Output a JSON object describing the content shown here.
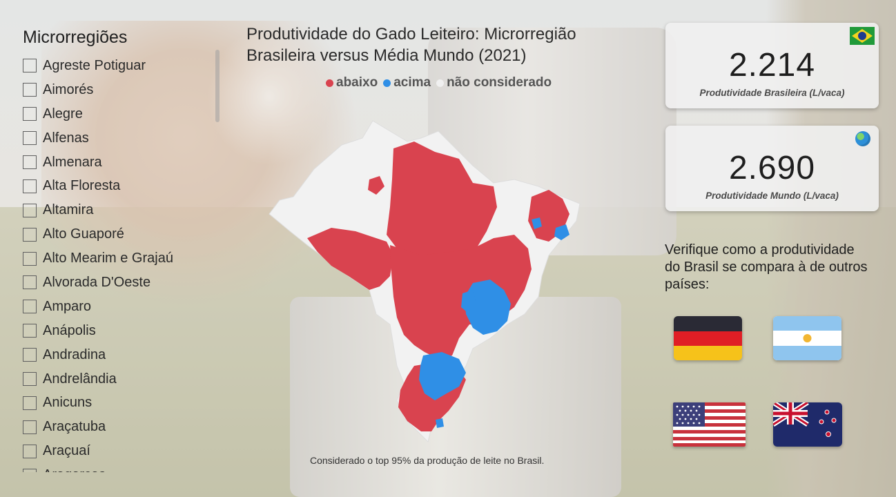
{
  "slicer": {
    "title": "Microrregiões",
    "items": [
      "Agreste Potiguar",
      "Aimorés",
      "Alegre",
      "Alfenas",
      "Almenara",
      "Alta Floresta",
      "Altamira",
      "Alto Guaporé",
      "Alto Mearim e Grajaú",
      "Alvorada D'Oeste",
      "Amparo",
      "Anápolis",
      "Andradina",
      "Andrelândia",
      "Anicuns",
      "Araçatuba",
      "Araçuaí",
      "Aragarças"
    ]
  },
  "map": {
    "title": "Produtividade do Gado Leiteiro: Microrregião Brasileira versus Média Mundo (2021)",
    "legend": [
      {
        "label": "abaixo",
        "color": "#d9434f"
      },
      {
        "label": "acima",
        "color": "#2f8fe6"
      },
      {
        "label": "não considerado",
        "color": "#f0f0f0"
      }
    ],
    "note": "Considerado o top 95% da produção de leite no Brasil."
  },
  "kpi": {
    "brazil": {
      "value": "2.214",
      "caption": "Produtividade Brasileira (L/vaca)",
      "icon": "brazil-flag-icon"
    },
    "world": {
      "value": "2.690",
      "caption": "Produtividade Mundo (L/vaca)",
      "icon": "globe-icon"
    }
  },
  "compare": {
    "text": "Verifique como a produtividade do Brasil se compara à de outros países:",
    "buttons": [
      "germany-flag",
      "argentina-flag",
      "usa-flag",
      "new-zealand-flag"
    ]
  },
  "colors": {
    "below": "#d9434f",
    "above": "#2f8fe6",
    "not_considered": "#f0f0f0"
  }
}
